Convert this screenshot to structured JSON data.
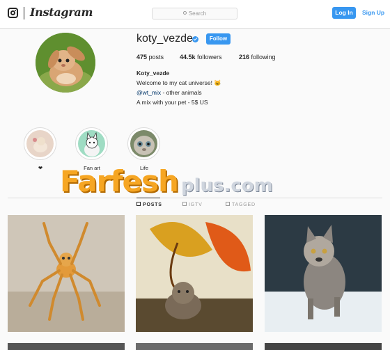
{
  "nav": {
    "brand": "Instagram",
    "search_placeholder": "Search",
    "login_label": "Log In",
    "signup_label": "Sign Up"
  },
  "profile": {
    "username": "koty_vezde",
    "verified": true,
    "follow_label": "Follow",
    "stats": {
      "posts_count": "475",
      "posts_label": "posts",
      "followers_count": "44.5k",
      "followers_label": "followers",
      "following_count": "216",
      "following_label": "following"
    },
    "bio": {
      "name": "Koty_vezde",
      "line1": "Welcome to my cat universe! 🐱",
      "mention": "@wt_mix",
      "line2_rest": " - other animals",
      "line3": "A mix with your pet - 5$ US"
    }
  },
  "highlights": [
    {
      "label": "❤"
    },
    {
      "label": "Fan art"
    },
    {
      "label": "Life"
    }
  ],
  "watermark": {
    "main": "Farfesh",
    "sub": "plus.com"
  },
  "tabs": [
    {
      "label": "POSTS",
      "icon": "grid-icon",
      "active": true
    },
    {
      "label": "IGTV",
      "icon": "tv-icon",
      "active": false
    },
    {
      "label": "TAGGED",
      "icon": "tag-icon",
      "active": false
    }
  ],
  "posts": [
    {
      "subject": "spider-cat"
    },
    {
      "subject": "cat-under-leaves"
    },
    {
      "subject": "wolf-cat"
    }
  ],
  "colors": {
    "accent": "#3897f0",
    "text": "#262626",
    "border": "#dbdbdb",
    "watermark_orange": "#f6a623"
  }
}
